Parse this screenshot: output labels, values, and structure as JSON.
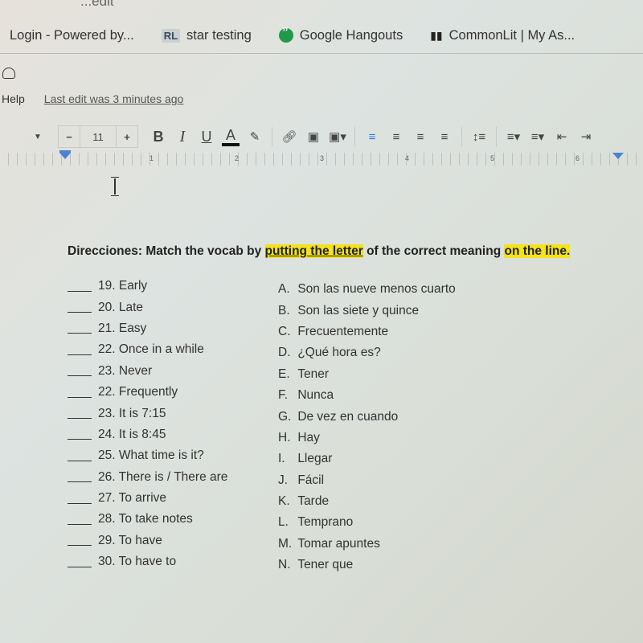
{
  "browser": {
    "url_partial": "...edit",
    "bookmarks": [
      {
        "label": "Login - Powered by...",
        "icon": "none"
      },
      {
        "label": "star testing",
        "icon": "rl-badge",
        "badge_text": "RL"
      },
      {
        "label": "Google Hangouts",
        "icon": "hangouts-icon"
      },
      {
        "label": "CommonLit | My As...",
        "icon": "book-icon"
      }
    ]
  },
  "docs": {
    "menu": {
      "help_label": "Help",
      "last_edit": "Last edit was 3 minutes ago"
    },
    "toolbar": {
      "font_size": "11",
      "minus_label": "−",
      "plus_label": "+",
      "bold_label": "B",
      "italic_label": "I",
      "underline_label": "U",
      "text_color_label": "A",
      "text_color": "#111111",
      "accent_color": "#3b78d8"
    },
    "ruler": {
      "numbers": [
        "1",
        "2",
        "3",
        "4",
        "5",
        "6"
      ]
    }
  },
  "worksheet": {
    "directions": {
      "prefix": "Direcciones:",
      "part1": " Match the vocab by ",
      "highlight1": "putting the letter",
      "part2": " of the correct meaning ",
      "highlight2": "on the line",
      "suffix": ".",
      "highlight_color": "#f3e21c"
    },
    "items": [
      "19. Early",
      "20. Late",
      "21. Easy",
      "22. Once in a while",
      "23. Never",
      "22. Frequently",
      "23. It is 7:15",
      "24. It is 8:45",
      "25. What time is it?",
      "26. There is / There are",
      "27. To arrive",
      "28. To take notes",
      "29. To have",
      "30. To have to"
    ],
    "options": [
      {
        "letter": "A.",
        "text": "Son las nueve menos cuarto"
      },
      {
        "letter": "B.",
        "text": "Son las siete y quince"
      },
      {
        "letter": "C.",
        "text": "Frecuentemente"
      },
      {
        "letter": "D.",
        "text": "¿Qué hora es?"
      },
      {
        "letter": "E.",
        "text": "Tener"
      },
      {
        "letter": "F.",
        "text": "Nunca"
      },
      {
        "letter": "G.",
        "text": "De vez en cuando"
      },
      {
        "letter": "H.",
        "text": "Hay"
      },
      {
        "letter": "I.",
        "text": "Llegar"
      },
      {
        "letter": "J.",
        "text": "Fácil"
      },
      {
        "letter": "K.",
        "text": "Tarde"
      },
      {
        "letter": "L.",
        "text": "Temprano"
      },
      {
        "letter": "M.",
        "text": "Tomar apuntes"
      },
      {
        "letter": "N.",
        "text": "Tener que"
      }
    ]
  }
}
